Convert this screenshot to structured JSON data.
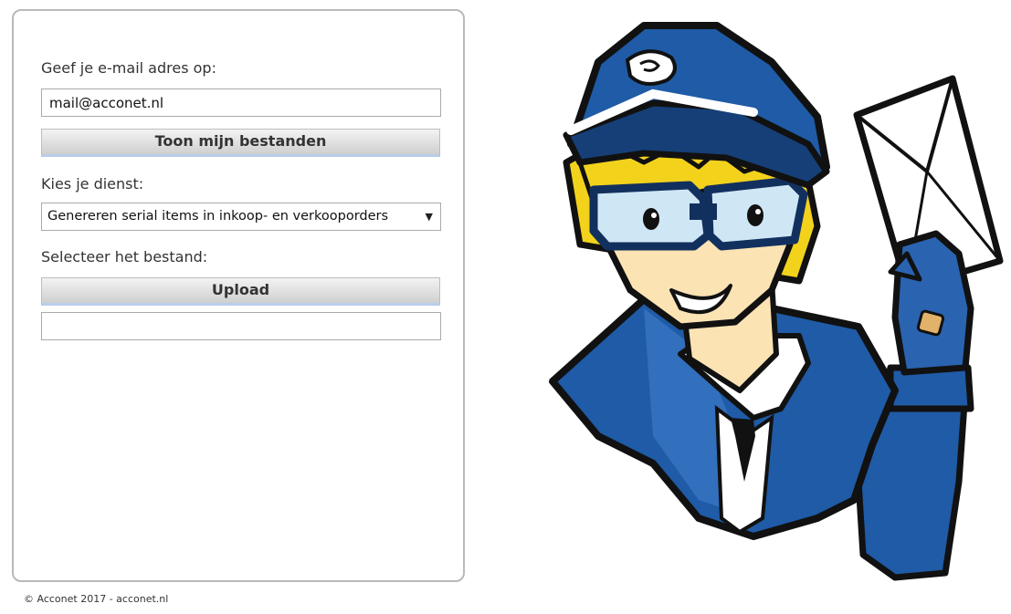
{
  "form": {
    "email_label": "Geef je e-mail adres op:",
    "email_value": "mail@acconet.nl",
    "show_files_button": "Toon mijn bestanden",
    "service_label": "Kies je dienst:",
    "service_selected": "Genereren serial items in inkoop- en verkooporders",
    "service_arrow": "▼",
    "file_label": "Selecteer het bestand:",
    "upload_button": "Upload",
    "file_value": ""
  },
  "footer": {
    "text": "© Acconet 2017 - acconet.nl"
  },
  "illustration": {
    "icon": "mailman-mascot",
    "colors": {
      "uniform": "#1f5ba6",
      "uniform_dark": "#163f78",
      "hair": "#f3d21c",
      "skin": "#fbe3b4",
      "goggle_lens": "#cfe6f5",
      "outline": "#111111",
      "shirt": "#ffffff",
      "envelope": "#ffffff"
    }
  }
}
